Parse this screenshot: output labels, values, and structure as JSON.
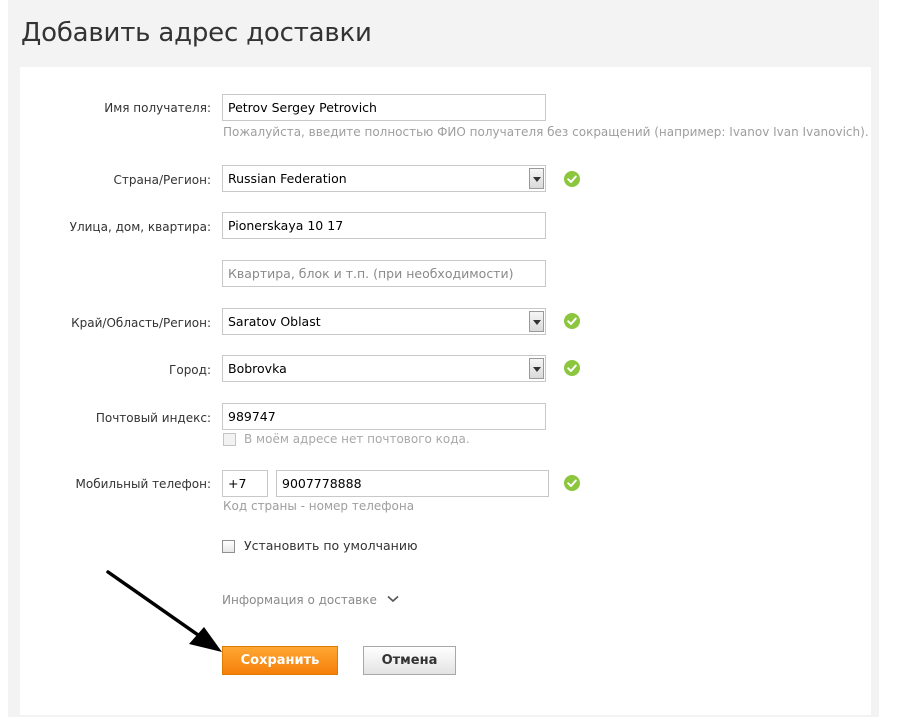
{
  "page": {
    "title": "Добавить адрес доставки"
  },
  "form": {
    "recipient": {
      "label": "Имя получателя:",
      "value": "Petrov Sergey Petrovich",
      "hint": "Пожалуйста, введите полностью ФИО получателя без сокращений (например: Ivanov Ivan Ivanovich)."
    },
    "country": {
      "label": "Страна/Регион:",
      "value": "Russian Federation"
    },
    "street": {
      "label": "Улица, дом, квартира:",
      "value": "Pionerskaya 10 17",
      "apartment_placeholder": "Квартира, блок и т.п. (при необходимости)"
    },
    "region": {
      "label": "Край/Область/Регион:",
      "value": "Saratov Oblast"
    },
    "city": {
      "label": "Город:",
      "value": "Bobrovka"
    },
    "postal": {
      "label": "Почтовый индекс:",
      "value": "989747",
      "no_code_label": "В моём адресе нет почтового кода."
    },
    "phone": {
      "label": "Мобильный телефон:",
      "country_code": "+7",
      "number": "9007778888",
      "hint": "Код страны - номер телефона"
    },
    "default_label": "Установить по умолчанию",
    "delivery_info_link": "Информация о доставке"
  },
  "buttons": {
    "save": "Сохранить",
    "cancel": "Отмена"
  },
  "colors": {
    "accent": "#f57f0a",
    "check": "#8cc63e",
    "hint_text": "#9e9e9e"
  }
}
